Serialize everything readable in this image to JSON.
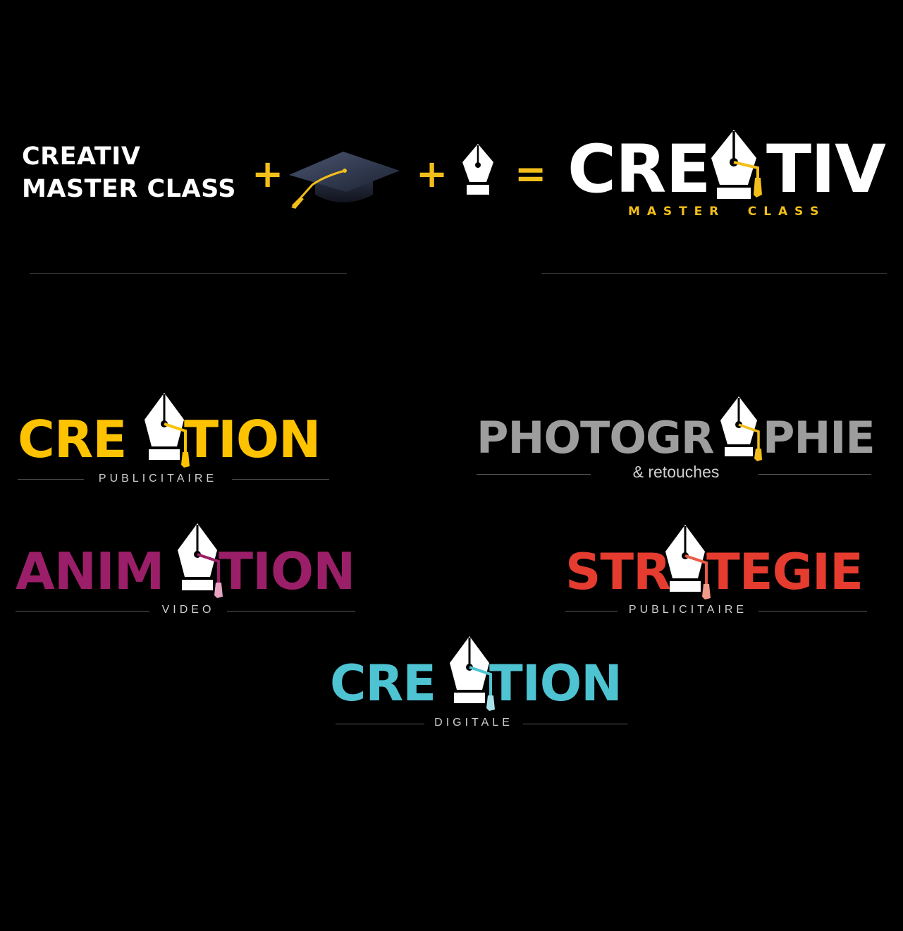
{
  "header": {
    "line1": "CREATIV",
    "line2": "MASTER CLASS",
    "plus1": "+",
    "plus2": "+",
    "equals": "="
  },
  "main_logo": {
    "left": "CRE",
    "right": "TIV",
    "tagline": "M A S T E R     C L A S S",
    "color": "#ffffff",
    "accent": "#f2be1a"
  },
  "logos": [
    {
      "left": "CRE",
      "right": "TION",
      "sub": "PUBLICITAIRE",
      "color": "#fdc300",
      "accent": "#fdc300"
    },
    {
      "left": "PHOTOGR",
      "right": "PHIE",
      "sub": "& retouches",
      "color": "#9d9d9d",
      "accent": "#f2be1a"
    },
    {
      "left": "ANIM",
      "right": "TION",
      "sub": "VIDEO",
      "color": "#9b1f68",
      "accent": "#9b1f68"
    },
    {
      "left": "STR",
      "right": "TEGIE",
      "sub": "PUBLICITAIRE",
      "color": "#e53c2f",
      "accent": "#e85c45"
    },
    {
      "left": "CRE",
      "right": "TION",
      "sub": "DIGITALE",
      "color": "#4ec3d2",
      "accent": "#4ec3d2"
    }
  ],
  "icons": {
    "cap": "graduation-cap-icon",
    "nib": "pen-nib-icon"
  }
}
